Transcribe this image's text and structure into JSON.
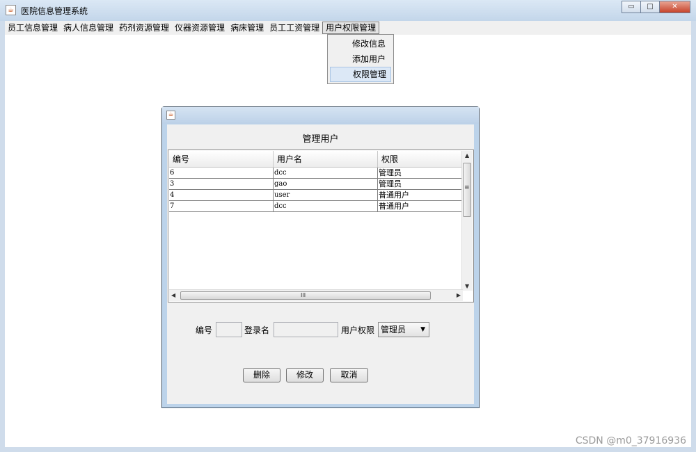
{
  "window": {
    "title": "医院信息管理系统",
    "minimize_glyph": "▭",
    "maximize_glyph": "□",
    "close_glyph": "✕"
  },
  "menubar": {
    "items": [
      "员工信息管理",
      "病人信息管理",
      "药剂资源管理",
      "仪器资源管理",
      "病床管理",
      "员工工资管理",
      "用户权限管理"
    ],
    "active_index": 6
  },
  "dropdown": {
    "items": [
      "修改信息",
      "添加用户",
      "权限管理"
    ],
    "hover_index": 2
  },
  "dialog": {
    "heading": "管理用户",
    "table": {
      "columns": [
        "编号",
        "用户名",
        "权限"
      ],
      "rows": [
        [
          "6",
          "dcc",
          "管理员"
        ],
        [
          "3",
          "gao",
          "管理员"
        ],
        [
          "4",
          "user",
          "普通用户"
        ],
        [
          "7",
          "dcc",
          "普通用户"
        ]
      ]
    },
    "form": {
      "id_label": "编号",
      "id_value": "",
      "login_label": "登录名",
      "login_value": "",
      "role_label": "用户权限",
      "role_selected": "管理员"
    },
    "buttons": {
      "delete": "删除",
      "modify": "修改",
      "cancel": "取消"
    }
  },
  "watermark": "CSDN @m0_37916936",
  "icons": {
    "app_icon": "java-cup-icon",
    "scroll_up": "▲",
    "scroll_down": "▼",
    "scroll_left": "◀",
    "scroll_right": "▶",
    "grip": "≡",
    "hgrip": "III",
    "caret": "▼"
  },
  "colors": {
    "titlebar": "#c3d6ea",
    "dropdown_hover": "#dce8f6",
    "close_button": "#c7432a"
  }
}
